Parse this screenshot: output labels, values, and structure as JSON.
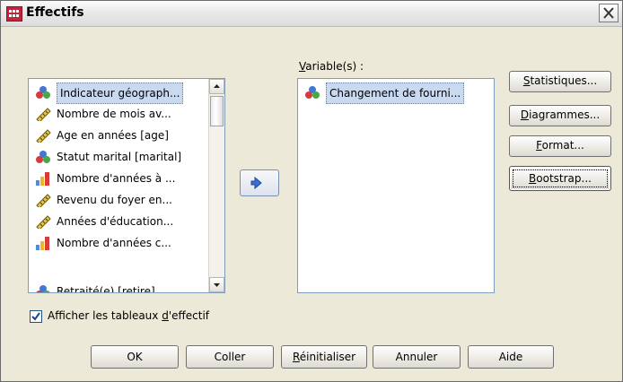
{
  "window": {
    "title": "Effectifs"
  },
  "source_list": {
    "items": [
      {
        "label": "Indicateur géograph...",
        "icon": "nominal-icon"
      },
      {
        "label": "Nombre de mois av...",
        "icon": "scale-ruler-icon"
      },
      {
        "label": "Age en années [age]",
        "icon": "scale-ruler-icon"
      },
      {
        "label": "Statut marital [marital]",
        "icon": "nominal-icon"
      },
      {
        "label": "Nombre d'années à ...",
        "icon": "ordinal-bars-icon"
      },
      {
        "label": "Revenu du foyer en...",
        "icon": "scale-ruler-icon"
      },
      {
        "label": "Années d'éducation...",
        "icon": "scale-ruler-icon"
      },
      {
        "label": "Nombre d'années c...",
        "icon": "ordinal-bars-icon"
      },
      {
        "label": "Retraité(e) [retire]",
        "icon": "nominal-icon"
      }
    ]
  },
  "target": {
    "label_prefix": "",
    "label_underline": "V",
    "label_rest": "ariable(s) :",
    "items": [
      {
        "label": "Changement de fourni...",
        "icon": "nominal-icon"
      }
    ]
  },
  "side_buttons": {
    "statistics": {
      "pre": "",
      "u": "S",
      "post": "tatistiques..."
    },
    "charts": {
      "pre": "",
      "u": "D",
      "post": "iagrammes..."
    },
    "format": {
      "pre": "",
      "u": "F",
      "post": "ormat..."
    },
    "bootstrap": {
      "pre": "",
      "u": "B",
      "post": "ootstrap..."
    }
  },
  "checkbox": {
    "pre": "Afficher les tableaux ",
    "u": "d",
    "post": "'effectif",
    "checked": true
  },
  "bottom_buttons": {
    "ok": "OK",
    "paste": "Coller",
    "reset": {
      "u": "R",
      "post": "éinitialiser"
    },
    "cancel": "Annuler",
    "help": "Aide"
  },
  "colors": {
    "selection": "#c9daf0",
    "arrow": "#3a6fd1"
  }
}
